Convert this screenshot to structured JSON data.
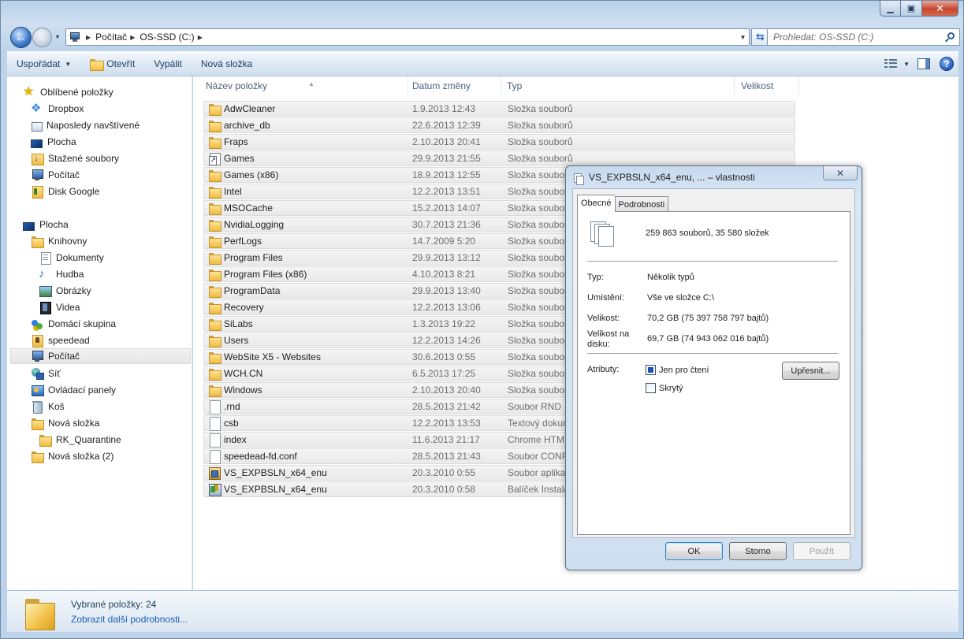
{
  "address": {
    "crumbs": [
      "Počítač",
      "OS-SSD (C:)"
    ]
  },
  "search": {
    "placeholder": "Prohledat: OS-SSD (C:)"
  },
  "toolbar": {
    "organize": "Uspořádat",
    "open": "Otevřít",
    "burn": "Vypálit",
    "new_folder": "Nová složka"
  },
  "navpane": {
    "items": [
      {
        "label": "Oblíbené položky",
        "icon": "star-icon"
      },
      {
        "label": "Dropbox",
        "icon": "dropbox-icon"
      },
      {
        "label": "Naposledy navštívené",
        "icon": "recent-places-icon"
      },
      {
        "label": "Plocha",
        "icon": "desktop-icon"
      },
      {
        "label": "Stažené soubory",
        "icon": "downloads-icon"
      },
      {
        "label": "Počítač",
        "icon": "computer-icon"
      },
      {
        "label": "Disk Google",
        "icon": "google-drive-icon"
      },
      {
        "label": "Plocha",
        "icon": "desktop-icon"
      },
      {
        "label": "Knihovny",
        "icon": "libraries-icon"
      },
      {
        "label": "Dokumenty",
        "icon": "documents-icon"
      },
      {
        "label": "Hudba",
        "icon": "music-icon"
      },
      {
        "label": "Obrázky",
        "icon": "pictures-icon"
      },
      {
        "label": "Videa",
        "icon": "videos-icon"
      },
      {
        "label": "Domácí skupina",
        "icon": "homegroup-icon"
      },
      {
        "label": "speedead",
        "icon": "user-folder-icon"
      },
      {
        "label": "Počítač",
        "icon": "computer-icon"
      },
      {
        "label": "Síť",
        "icon": "network-icon"
      },
      {
        "label": "Ovládací panely",
        "icon": "control-panel-icon"
      },
      {
        "label": "Koš",
        "icon": "recycle-bin-icon"
      },
      {
        "label": "Nová složka",
        "icon": "folder-icon"
      },
      {
        "label": "RK_Quarantine",
        "icon": "folder-icon"
      },
      {
        "label": "Nová složka (2)",
        "icon": "folder-icon"
      }
    ]
  },
  "columns": {
    "name": "Název položky",
    "date": "Datum změny",
    "type": "Typ",
    "size": "Velikost"
  },
  "files": [
    {
      "name": "AdwCleaner",
      "date": "1.9.2013 12:43",
      "type": "Složka souborů"
    },
    {
      "name": "archive_db",
      "date": "22.6.2013 12:39",
      "type": "Složka souborů"
    },
    {
      "name": "Fraps",
      "date": "2.10.2013 20:41",
      "type": "Složka souborů"
    },
    {
      "name": "Games",
      "date": "29.9.2013 21:55",
      "type": "Složka souborů"
    },
    {
      "name": "Games (x86)",
      "date": "18.9.2013 12:55",
      "type": "Složka souborů"
    },
    {
      "name": "Intel",
      "date": "12.2.2013 13:51",
      "type": "Složka souborů"
    },
    {
      "name": "MSOCache",
      "date": "15.2.2013 14:07",
      "type": "Složka souborů"
    },
    {
      "name": "NvidiaLogging",
      "date": "30.7.2013 21:36",
      "type": "Složka souborů"
    },
    {
      "name": "PerfLogs",
      "date": "14.7.2009 5:20",
      "type": "Složka souborů"
    },
    {
      "name": "Program Files",
      "date": "29.9.2013 13:12",
      "type": "Složka souborů"
    },
    {
      "name": "Program Files (x86)",
      "date": "4.10.2013 8:21",
      "type": "Složka souborů"
    },
    {
      "name": "ProgramData",
      "date": "29.9.2013 13:40",
      "type": "Složka souborů"
    },
    {
      "name": "Recovery",
      "date": "12.2.2013 13:06",
      "type": "Složka souborů"
    },
    {
      "name": "SiLabs",
      "date": "1.3.2013 19:22",
      "type": "Složka souborů"
    },
    {
      "name": "Users",
      "date": "12.2.2013 14:26",
      "type": "Složka souborů"
    },
    {
      "name": "WebSite X5 - Websites",
      "date": "30.6.2013 0:55",
      "type": "Složka souborů"
    },
    {
      "name": "WCH.CN",
      "date": "6.5.2013 17:25",
      "type": "Složka souborů"
    },
    {
      "name": "Windows",
      "date": "2.10.2013 20:40",
      "type": "Složka souborů"
    },
    {
      "name": ".rnd",
      "date": "28.5.2013 21:42",
      "type": "Soubor RND"
    },
    {
      "name": "csb",
      "date": "12.2.2013 13:53",
      "type": "Textový dokum"
    },
    {
      "name": "index",
      "date": "11.6.2013 21:17",
      "type": "Chrome HTM"
    },
    {
      "name": "speedead-fd.conf",
      "date": "28.5.2013 21:43",
      "type": "Soubor CONF"
    },
    {
      "name": "VS_EXPBSLN_x64_enu",
      "date": "20.3.2010 0:55",
      "type": "Soubor aplikac"
    },
    {
      "name": "VS_EXPBSLN_x64_enu",
      "date": "20.3.2010 0:58",
      "type": "Balíček Instala"
    }
  ],
  "file_icons": [
    "folder-icon",
    "folder-icon",
    "folder-icon",
    "shortcut-icon",
    "folder-icon",
    "folder-icon",
    "folder-icon",
    "folder-icon",
    "folder-icon",
    "folder-icon",
    "folder-icon",
    "folder-icon",
    "folder-icon",
    "folder-icon",
    "folder-icon",
    "folder-icon",
    "folder-icon",
    "folder-icon",
    "file-icon",
    "file-icon",
    "file-icon",
    "file-icon",
    "setup-icon",
    "installer-package-icon"
  ],
  "details": {
    "selected": "Vybrané položky: 24",
    "more_link": "Zobrazit další podrobnosti..."
  },
  "dialog": {
    "title": "VS_EXPBSLN_x64_enu, ... – vlastnosti",
    "tabs": [
      "Obecné",
      "Podrobnosti"
    ],
    "summary": "259 863 souborů, 35 580 složek",
    "type_label": "Typ:",
    "type_value": "Několik typů",
    "location_label": "Umístění:",
    "location_value": "Vše ve složce C:\\",
    "size_label": "Velikost:",
    "size_value": "70,2 GB (75 397 758 797 bajtů)",
    "disk_size_label": "Velikost na disku:",
    "disk_size_value": "69,7 GB (74 943 062 016 bajtů)",
    "attributes_label": "Atributy:",
    "readonly_label": "Jen pro čtení",
    "hidden_label": "Skrytý",
    "advanced_button": "Upřesnit...",
    "ok_button": "OK",
    "cancel_button": "Storno",
    "apply_button": "Použít"
  }
}
